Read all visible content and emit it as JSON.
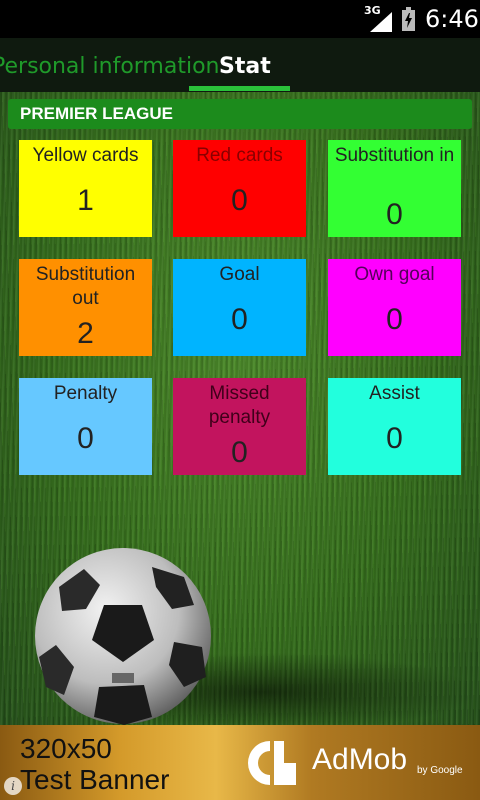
{
  "status_bar": {
    "network": "3G",
    "time": "6:46"
  },
  "tabs": [
    {
      "label": "Personal information",
      "selected": false
    },
    {
      "label": "Stat",
      "selected": true
    }
  ],
  "league": {
    "title": "PREMIER LEAGUE"
  },
  "stats": [
    {
      "label": "Yellow cards",
      "value": "1",
      "color": "#ffff00"
    },
    {
      "label": "Red cards",
      "value": "0",
      "color": "#ff0000"
    },
    {
      "label": "Substitution in",
      "value": "0",
      "color": "#33ff33"
    },
    {
      "label": "Substitution out",
      "value": "2",
      "color": "#ff9000"
    },
    {
      "label": "Goal",
      "value": "0",
      "color": "#00b4ff"
    },
    {
      "label": "Own goal",
      "value": "0",
      "color": "#ff00ff"
    },
    {
      "label": "Penalty",
      "value": "0",
      "color": "#66c8ff"
    },
    {
      "label": "Missed penalty",
      "value": "0",
      "color": "#c2145e"
    },
    {
      "label": "Assist",
      "value": "0",
      "color": "#22ffdd"
    }
  ],
  "ad": {
    "line1": "320x50",
    "line2": "Test Banner",
    "brand": "AdMob",
    "brand_sub": "by Google",
    "icon": "info-icon"
  }
}
